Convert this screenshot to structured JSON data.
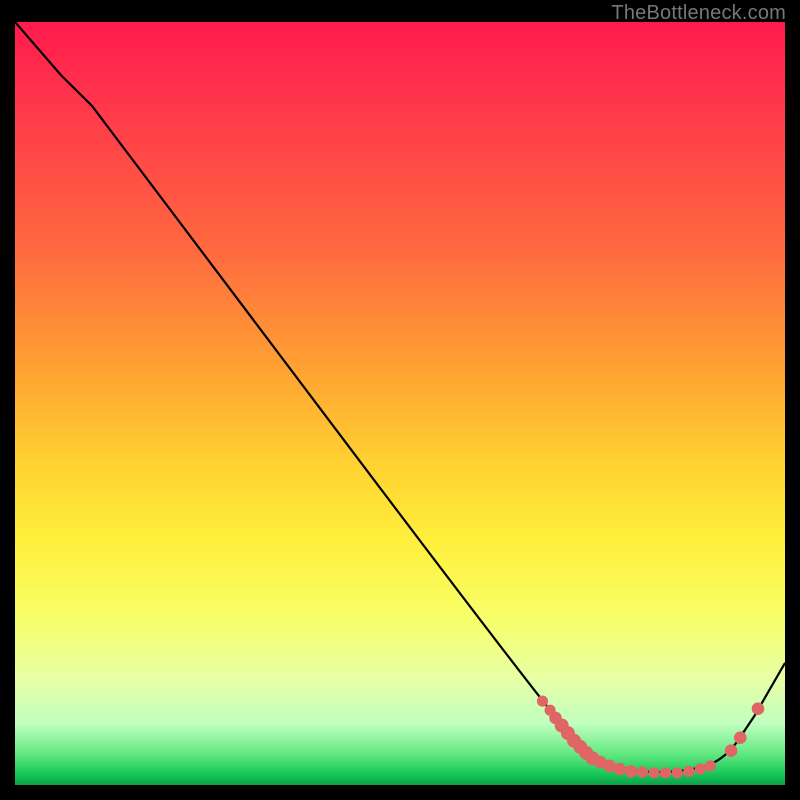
{
  "watermark": "TheBottleneck.com",
  "chart_data": {
    "type": "line",
    "title": "",
    "xlabel": "",
    "ylabel": "",
    "xlim": [
      0,
      100
    ],
    "ylim": [
      0,
      100
    ],
    "series": [
      {
        "name": "curve",
        "points": [
          {
            "x": 0,
            "y": 100
          },
          {
            "x": 6,
            "y": 93
          },
          {
            "x": 10,
            "y": 89
          },
          {
            "x": 69,
            "y": 10
          },
          {
            "x": 75,
            "y": 3.5
          },
          {
            "x": 80,
            "y": 1.8
          },
          {
            "x": 86,
            "y": 1.6
          },
          {
            "x": 92,
            "y": 3.0
          },
          {
            "x": 96,
            "y": 9
          },
          {
            "x": 100,
            "y": 16
          }
        ]
      }
    ],
    "markers": [
      {
        "x": 68.5,
        "y": 11.0,
        "r": 0.8
      },
      {
        "x": 69.5,
        "y": 9.8,
        "r": 0.8
      },
      {
        "x": 70.2,
        "y": 8.8,
        "r": 0.9
      },
      {
        "x": 71.0,
        "y": 7.8,
        "r": 1.0
      },
      {
        "x": 71.8,
        "y": 6.8,
        "r": 1.0
      },
      {
        "x": 72.6,
        "y": 5.8,
        "r": 1.0
      },
      {
        "x": 73.4,
        "y": 5.0,
        "r": 1.0
      },
      {
        "x": 74.2,
        "y": 4.2,
        "r": 1.0
      },
      {
        "x": 75.0,
        "y": 3.5,
        "r": 1.0
      },
      {
        "x": 76.0,
        "y": 3.0,
        "r": 0.9
      },
      {
        "x": 77.2,
        "y": 2.5,
        "r": 0.9
      },
      {
        "x": 78.5,
        "y": 2.1,
        "r": 0.9
      },
      {
        "x": 80.0,
        "y": 1.8,
        "r": 0.9
      },
      {
        "x": 81.5,
        "y": 1.7,
        "r": 0.8
      },
      {
        "x": 83.0,
        "y": 1.6,
        "r": 0.8
      },
      {
        "x": 84.5,
        "y": 1.6,
        "r": 0.8
      },
      {
        "x": 86.0,
        "y": 1.6,
        "r": 0.8
      },
      {
        "x": 87.5,
        "y": 1.8,
        "r": 0.8
      },
      {
        "x": 89.0,
        "y": 2.1,
        "r": 0.8
      },
      {
        "x": 90.3,
        "y": 2.5,
        "r": 0.8
      },
      {
        "x": 93.0,
        "y": 4.5,
        "r": 0.9
      },
      {
        "x": 94.2,
        "y": 6.2,
        "r": 0.9
      },
      {
        "x": 96.5,
        "y": 10.0,
        "r": 0.9
      }
    ],
    "marker_color": "#e06666",
    "curve_color": "#000000"
  }
}
